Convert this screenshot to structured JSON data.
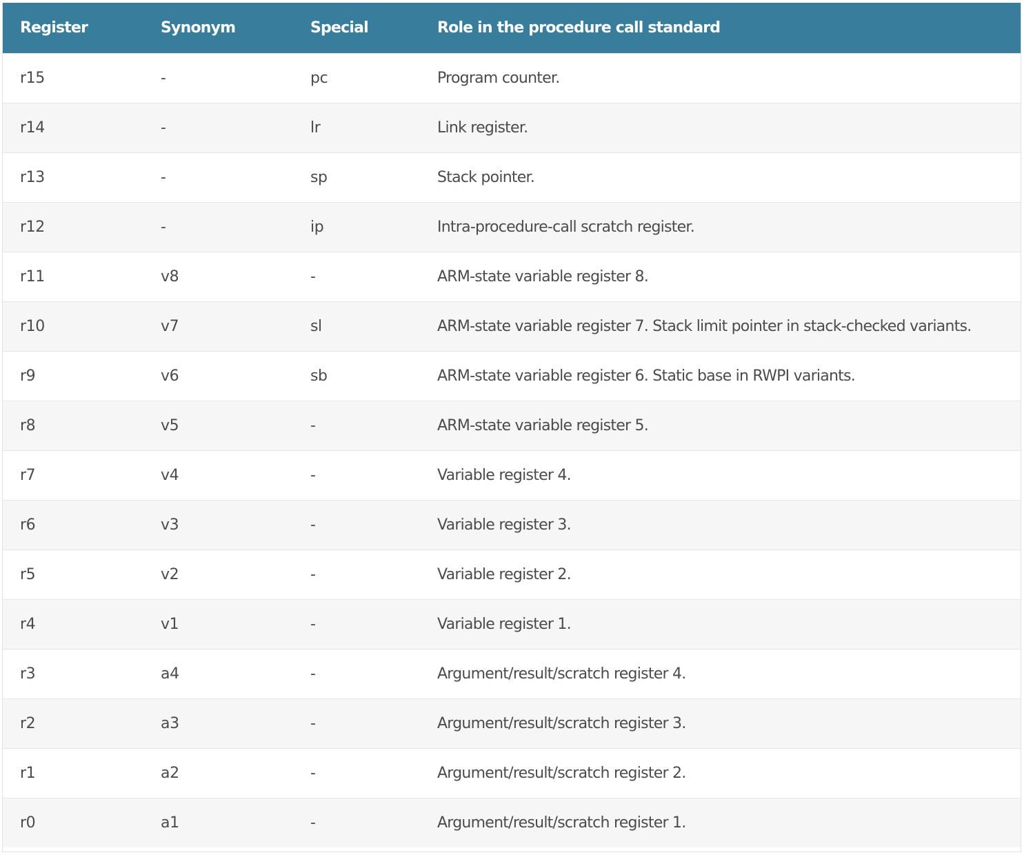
{
  "table": {
    "headers": [
      "Register",
      "Synonym",
      "Special",
      "Role in the procedure call standard"
    ],
    "rows": [
      [
        "r15",
        "-",
        "pc",
        "Program counter."
      ],
      [
        "r14",
        "-",
        "lr",
        "Link register."
      ],
      [
        "r13",
        "-",
        "sp",
        "Stack pointer."
      ],
      [
        "r12",
        "-",
        "ip",
        "Intra-procedure-call scratch register."
      ],
      [
        "r11",
        "v8",
        "-",
        "ARM-state variable register 8."
      ],
      [
        "r10",
        "v7",
        "sl",
        "ARM-state variable register 7. Stack limit pointer in stack-checked variants."
      ],
      [
        "r9",
        "v6",
        "sb",
        "ARM-state variable register 6. Static base in RWPI variants."
      ],
      [
        "r8",
        "v5",
        "-",
        "ARM-state variable register 5."
      ],
      [
        "r7",
        "v4",
        "-",
        "Variable register 4."
      ],
      [
        "r6",
        "v3",
        "-",
        "Variable register 3."
      ],
      [
        "r5",
        "v2",
        "-",
        "Variable register 2."
      ],
      [
        "r4",
        "v1",
        "-",
        "Variable register 1."
      ],
      [
        "r3",
        "a4",
        "-",
        "Argument/result/scratch register 4."
      ],
      [
        "r2",
        "a3",
        "-",
        "Argument/result/scratch register 3."
      ],
      [
        "r1",
        "a2",
        "-",
        "Argument/result/scratch register 2."
      ],
      [
        "r0",
        "a1",
        "-",
        "Argument/result/scratch register 1."
      ]
    ]
  },
  "colors": {
    "header_bg": "#387d9b",
    "header_text": "#ffffff",
    "row_alt_bg": "#f6f6f6",
    "cell_text": "#4b4b4b"
  }
}
